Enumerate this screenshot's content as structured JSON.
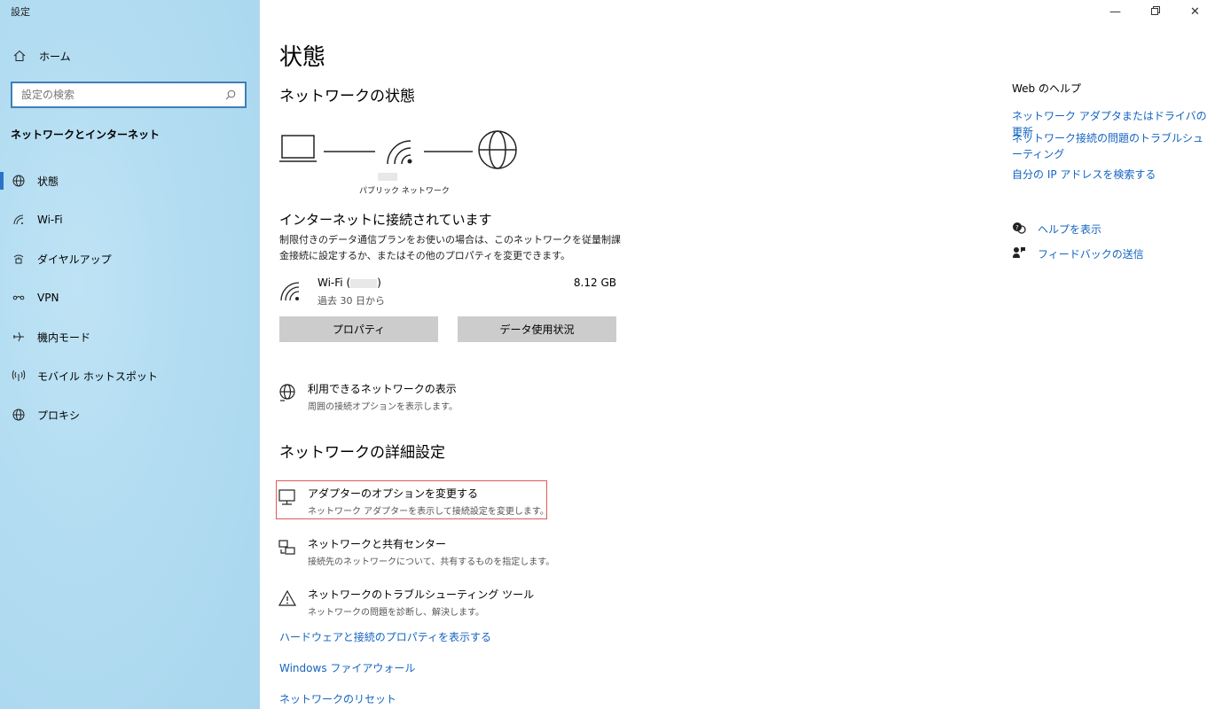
{
  "window": {
    "title": "設定"
  },
  "sidebar": {
    "home_label": "ホーム",
    "search_placeholder": "設定の検索",
    "section_heading": "ネットワークとインターネット",
    "items": [
      {
        "label": "状態",
        "icon": "globe-status-icon",
        "active": true
      },
      {
        "label": "Wi-Fi",
        "icon": "wifi-icon"
      },
      {
        "label": "ダイヤルアップ",
        "icon": "dialup-icon"
      },
      {
        "label": "VPN",
        "icon": "vpn-icon"
      },
      {
        "label": "機内モード",
        "icon": "airplane-icon"
      },
      {
        "label": "モバイル ホットスポット",
        "icon": "hotspot-icon"
      },
      {
        "label": "プロキシ",
        "icon": "globe-icon"
      }
    ]
  },
  "main": {
    "title": "状態",
    "network_status_heading": "ネットワークの状態",
    "network_type_label": "パブリック ネットワーク",
    "connection_title": "インターネットに接続されています",
    "connection_desc": "制限付きのデータ通信プランをお使いの場合は、このネットワークを従量制課金接続に設定するか、またはその他のプロパティを変更できます。",
    "wifi": {
      "name": "Wi-Fi (",
      "name_close": ")",
      "period": "過去 30 日から",
      "usage": "8.12 GB"
    },
    "buttons": {
      "properties": "プロパティ",
      "data_usage": "データ使用状況"
    },
    "show_networks": {
      "title": "利用できるネットワークの表示",
      "desc": "周囲の接続オプションを表示します。"
    },
    "advanced_heading": "ネットワークの詳細設定",
    "advanced_items": [
      {
        "title": "アダプターのオプションを変更する",
        "desc": "ネットワーク アダプターを表示して接続設定を変更します。"
      },
      {
        "title": "ネットワークと共有センター",
        "desc": "接続先のネットワークについて、共有するものを指定します。"
      },
      {
        "title": "ネットワークのトラブルシューティング ツール",
        "desc": "ネットワークの問題を診断し、解決します。"
      }
    ],
    "links": [
      "ハードウェアと接続のプロパティを表示する",
      "Windows ファイアウォール",
      "ネットワークのリセット"
    ]
  },
  "right": {
    "help_heading": "Web のヘルプ",
    "help_links": [
      "ネットワーク アダプタまたはドライバの更新",
      "ネットワーク接続の問題のトラブルシューティング",
      "自分の IP アドレスを検索する"
    ],
    "get_help": "ヘルプを表示",
    "feedback": "フィードバックの送信"
  },
  "colors": {
    "accent": "#2a72c6",
    "link": "#1464c0",
    "highlight_border": "#e05a5a",
    "sidebar_bg": "#b2dcf1"
  }
}
